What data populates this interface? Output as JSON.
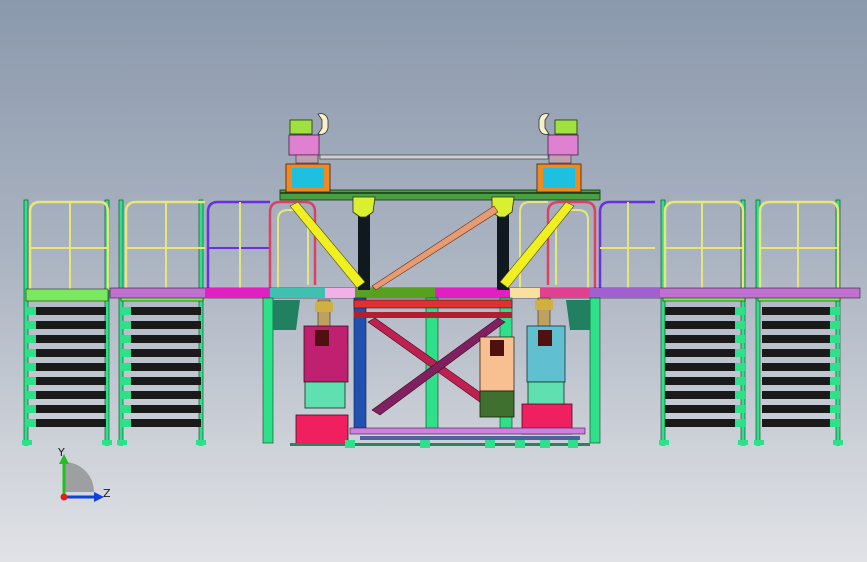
{
  "triad": {
    "y_label": "Y",
    "z_label": "Z",
    "colors": {
      "y": "#20c020",
      "z": "#1040e0",
      "x": "#e02020"
    }
  },
  "palette": {
    "frame_green": "#2fe08a",
    "rail_yellow": "#e6e67a",
    "stair_tread": "#1a1a1a",
    "magenta_beam": "#e020c0",
    "yellow_brace": "#f0f020",
    "orange_brace": "#e89a70",
    "blue_column": "#2050b0",
    "red_base": "#f02060",
    "pink_block": "#e080d0",
    "orange_motor": "#f08a20",
    "cyan_motor": "#20b0d0"
  }
}
